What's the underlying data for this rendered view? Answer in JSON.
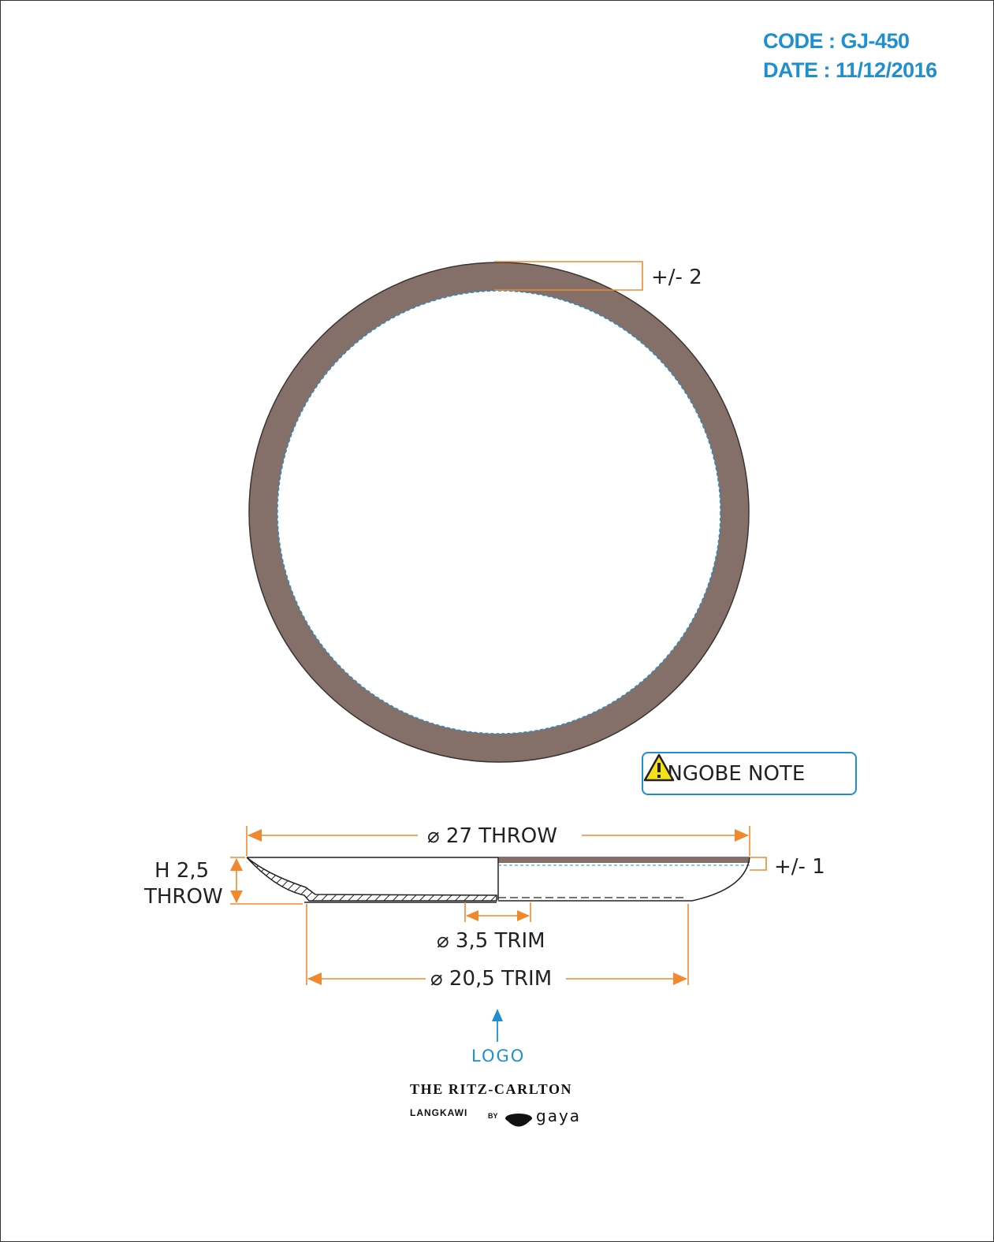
{
  "header": {
    "code": "CODE : GJ-450",
    "date": "DATE : 11/12/2016"
  },
  "dimensions": {
    "rim_tolerance": "+/- 2",
    "height_tolerance": "+/- 1",
    "throw_diameter": "⌀ 27 THROW",
    "height_line1": "H 2,5",
    "height_line2": "THROW",
    "foot_diameter": "⌀ 3,5 TRIM",
    "trim_diameter": "⌀ 20,5 TRIM"
  },
  "note": {
    "label": "ENGOBE NOTE"
  },
  "logo": {
    "label": "LOGO",
    "brand": "THE RITZ-CARLTON",
    "location": "LANGKAWI",
    "by": "BY",
    "partner": "gaya"
  },
  "colors": {
    "engobe": "#857069",
    "dimension": "#f0892e",
    "accent": "#1f8fcf"
  }
}
